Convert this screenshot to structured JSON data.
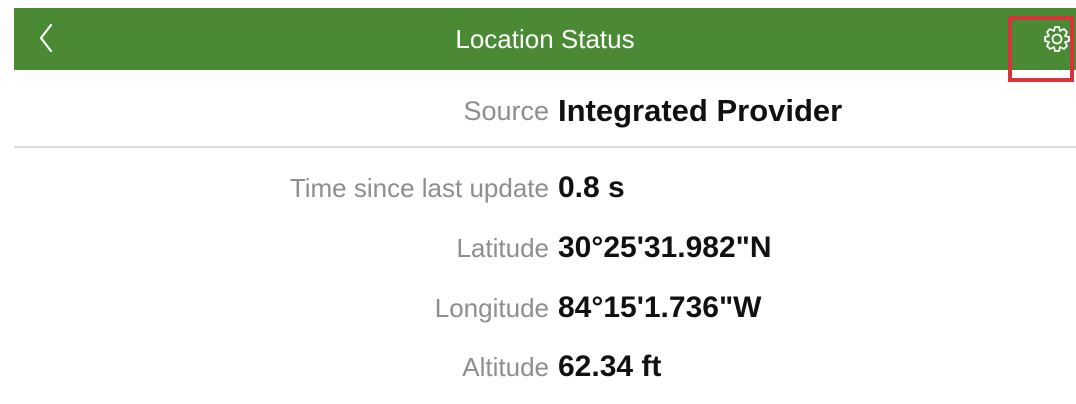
{
  "header": {
    "title": "Location Status",
    "back_icon": "chevron-left-icon",
    "settings_icon": "gear-icon"
  },
  "source": {
    "label": "Source",
    "value": "Integrated Provider"
  },
  "details": [
    {
      "label": "Time since last update",
      "value": "0.8 s"
    },
    {
      "label": "Latitude",
      "value": "30°25'31.982\"N"
    },
    {
      "label": "Longitude",
      "value": "84°15'1.736\"W"
    },
    {
      "label": "Altitude",
      "value": "62.34 ft"
    }
  ],
  "colors": {
    "header_background": "#4a8a35",
    "header_text": "#ffffff",
    "highlight_border": "#d6333a",
    "label_text": "#8e8e8e",
    "value_text": "#111111"
  }
}
